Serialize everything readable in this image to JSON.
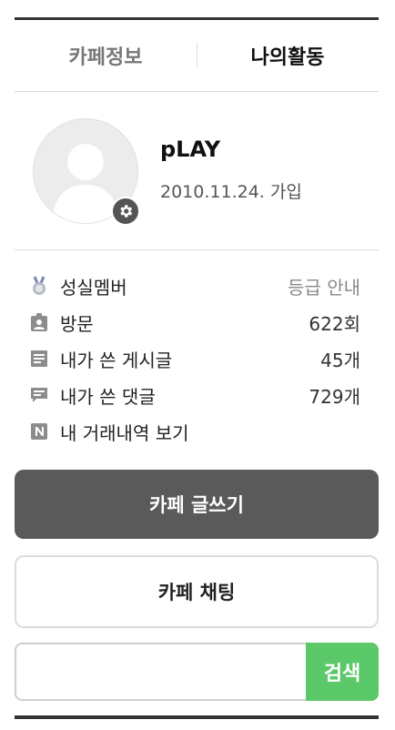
{
  "tabs": [
    {
      "label": "카페정보",
      "active": false
    },
    {
      "label": "나의활동",
      "active": true
    }
  ],
  "profile": {
    "nickname": "pLAY",
    "joined": "2010.11.24. 가입",
    "settings_icon": "gear-icon"
  },
  "stats": [
    {
      "icon": "medal-icon",
      "label": "성실멤버",
      "value": "등급 안내"
    },
    {
      "icon": "visit-icon",
      "label": "방문",
      "value": "622회"
    },
    {
      "icon": "document-icon",
      "label": "내가 쓴 게시글",
      "value": "45개"
    },
    {
      "icon": "comment-icon",
      "label": "내가 쓴 댓글",
      "value": "729개"
    },
    {
      "icon": "n-badge-icon",
      "label": "내 거래내역 보기",
      "value": ""
    }
  ],
  "buttons": {
    "write": "카페 글쓰기",
    "chat": "카페 채팅"
  },
  "search": {
    "placeholder": "",
    "button": "검색"
  },
  "colors": {
    "write_button_bg": "#5a5a5a",
    "search_button_bg": "#5bc96a"
  }
}
